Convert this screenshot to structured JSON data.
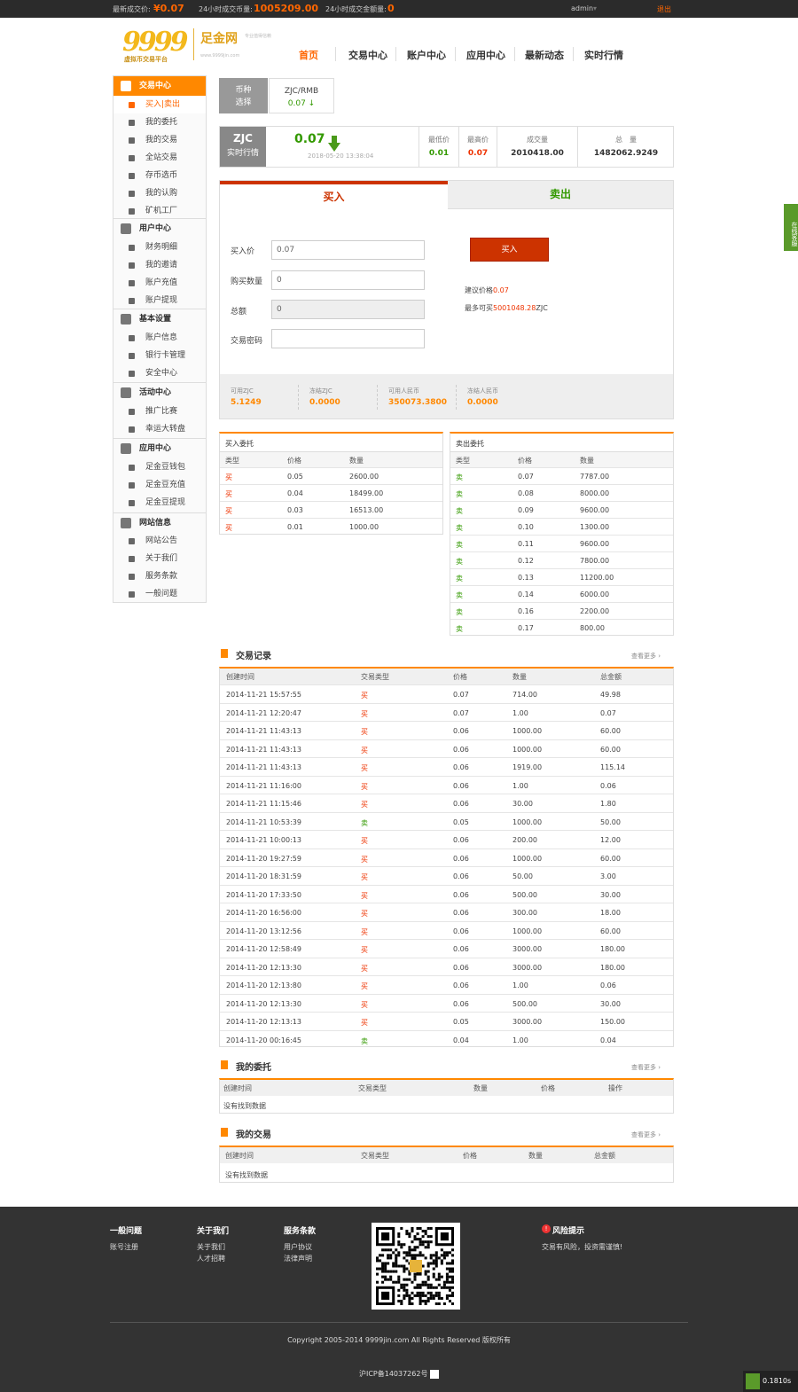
{
  "topbar": {
    "last_price_label": "最新成交价:",
    "last_price": "¥0.07",
    "vol24_label": "24小时成交币量:",
    "vol24": "1005209.00",
    "amt24_label": "24小时成交金额量:",
    "amt24": "0",
    "user": "admin",
    "logout": "退出"
  },
  "logo": {
    "digits": "9999",
    "title": "足金网",
    "slogan": "专业值得信赖",
    "sub": "虚拟币交易平台",
    "url": "www.9999jin.com"
  },
  "nav": [
    "首页",
    "交易中心",
    "账户中心",
    "应用中心",
    "最新动态",
    "实时行情"
  ],
  "sidebar": {
    "groups": [
      {
        "title": "交易中心",
        "items": [
          "买入|卖出",
          "我的委托",
          "我的交易",
          "全站交易",
          "存币选币",
          "我的认购",
          "矿机工厂"
        ]
      },
      {
        "title": "用户中心",
        "items": [
          "财务明细",
          "我的邀请",
          "账户充值",
          "账户提现"
        ]
      },
      {
        "title": "基本设置",
        "items": [
          "账户信息",
          "银行卡管理",
          "安全中心"
        ]
      },
      {
        "title": "活动中心",
        "items": [
          "推广比赛",
          "幸运大转盘"
        ]
      },
      {
        "title": "应用中心",
        "items": [
          "足金豆钱包",
          "足金豆充值",
          "足金豆提现"
        ]
      },
      {
        "title": "网站信息",
        "items": [
          "网站公告",
          "关于我们",
          "服务条款",
          "一般问题"
        ]
      }
    ]
  },
  "coin": {
    "select_label1": "币种",
    "select_label2": "选择",
    "pair": "ZJC/RMB",
    "pair_price": "0.07 ↓"
  },
  "ticker": {
    "code": "ZJC",
    "sub": "实时行情",
    "price": "0.07",
    "time": "2018-05-20 13:38:04",
    "low_label": "最低价",
    "low": "0.01",
    "high_label": "最高价",
    "high": "0.07",
    "vol_label": "成交量",
    "vol": "2010418.00",
    "total_label": "总　量",
    "total": "1482062.9249"
  },
  "trade": {
    "tab_buy": "买入",
    "tab_sell": "卖出",
    "price_label": "买入价",
    "price": "0.07",
    "amount_label": "购买数量",
    "amount": "0",
    "total_label": "总额",
    "total": "0",
    "pwd_label": "交易密码",
    "pwd": "",
    "button": "买入",
    "suggest_label": "建议价格",
    "suggest": "0.07",
    "max_label": "最多可买",
    "max": "5001048.28",
    "max_unit": "ZJC"
  },
  "balances": [
    {
      "label": "可用ZJC",
      "value": "5.1249"
    },
    {
      "label": "冻结ZJC",
      "value": "0.0000"
    },
    {
      "label": "可用人民币",
      "value": "350073.3800"
    },
    {
      "label": "冻结人民币",
      "value": "0.0000"
    }
  ],
  "buy_orders": {
    "title": "买入委托",
    "headers": [
      "类型",
      "价格",
      "数量"
    ],
    "rows": [
      [
        "买",
        "0.05",
        "2600.00"
      ],
      [
        "买",
        "0.04",
        "18499.00"
      ],
      [
        "买",
        "0.03",
        "16513.00"
      ],
      [
        "买",
        "0.01",
        "1000.00"
      ]
    ]
  },
  "sell_orders": {
    "title": "卖出委托",
    "headers": [
      "类型",
      "价格",
      "数量"
    ],
    "rows": [
      [
        "卖",
        "0.07",
        "7787.00"
      ],
      [
        "卖",
        "0.08",
        "8000.00"
      ],
      [
        "卖",
        "0.09",
        "9600.00"
      ],
      [
        "卖",
        "0.10",
        "1300.00"
      ],
      [
        "卖",
        "0.11",
        "9600.00"
      ],
      [
        "卖",
        "0.12",
        "7800.00"
      ],
      [
        "卖",
        "0.13",
        "11200.00"
      ],
      [
        "卖",
        "0.14",
        "6000.00"
      ],
      [
        "卖",
        "0.16",
        "2200.00"
      ],
      [
        "卖",
        "0.17",
        "800.00"
      ]
    ]
  },
  "records": {
    "title": "交易记录",
    "more": "查看更多 ›",
    "headers": [
      "创建时间",
      "交易类型",
      "价格",
      "数量",
      "总金额"
    ],
    "rows": [
      [
        "2014-11-21 15:57:55",
        "买",
        "0.07",
        "714.00",
        "49.98"
      ],
      [
        "2014-11-21 12:20:47",
        "买",
        "0.07",
        "1.00",
        "0.07"
      ],
      [
        "2014-11-21 11:43:13",
        "买",
        "0.06",
        "1000.00",
        "60.00"
      ],
      [
        "2014-11-21 11:43:13",
        "买",
        "0.06",
        "1000.00",
        "60.00"
      ],
      [
        "2014-11-21 11:43:13",
        "买",
        "0.06",
        "1919.00",
        "115.14"
      ],
      [
        "2014-11-21 11:16:00",
        "买",
        "0.06",
        "1.00",
        "0.06"
      ],
      [
        "2014-11-21 11:15:46",
        "买",
        "0.06",
        "30.00",
        "1.80"
      ],
      [
        "2014-11-21 10:53:39",
        "卖",
        "0.05",
        "1000.00",
        "50.00"
      ],
      [
        "2014-11-21 10:00:13",
        "买",
        "0.06",
        "200.00",
        "12.00"
      ],
      [
        "2014-11-20 19:27:59",
        "买",
        "0.06",
        "1000.00",
        "60.00"
      ],
      [
        "2014-11-20 18:31:59",
        "买",
        "0.06",
        "50.00",
        "3.00"
      ],
      [
        "2014-11-20 17:33:50",
        "买",
        "0.06",
        "500.00",
        "30.00"
      ],
      [
        "2014-11-20 16:56:00",
        "买",
        "0.06",
        "300.00",
        "18.00"
      ],
      [
        "2014-11-20 13:12:56",
        "买",
        "0.06",
        "1000.00",
        "60.00"
      ],
      [
        "2014-11-20 12:58:49",
        "买",
        "0.06",
        "3000.00",
        "180.00"
      ],
      [
        "2014-11-20 12:13:30",
        "买",
        "0.06",
        "3000.00",
        "180.00"
      ],
      [
        "2014-11-20 12:13:80",
        "买",
        "0.06",
        "1.00",
        "0.06"
      ],
      [
        "2014-11-20 12:13:30",
        "买",
        "0.06",
        "500.00",
        "30.00"
      ],
      [
        "2014-11-20 12:13:13",
        "买",
        "0.05",
        "3000.00",
        "150.00"
      ],
      [
        "2014-11-20 00:16:45",
        "卖",
        "0.04",
        "1.00",
        "0.04"
      ]
    ]
  },
  "my_orders": {
    "title": "我的委托",
    "more": "查看更多 ›",
    "headers": [
      "创建时间",
      "交易类型",
      "数量",
      "价格",
      "操作"
    ],
    "empty": "没有找到数据"
  },
  "my_trades": {
    "title": "我的交易",
    "more": "查看更多 ›",
    "headers": [
      "创建时间",
      "交易类型",
      "价格",
      "数量",
      "总金额"
    ],
    "empty": "没有找到数据"
  },
  "side_service": "在线客服",
  "footer": {
    "cols": [
      {
        "title": "一般问题",
        "links": [
          "账号注册"
        ]
      },
      {
        "title": "关于我们",
        "links": [
          "关于我们",
          "人才招聘"
        ]
      },
      {
        "title": "服务条款",
        "links": [
          "用户协议",
          "法律声明"
        ]
      }
    ],
    "risk_title": "风险提示",
    "risk_text": "交易有风险，投资需谨慎!",
    "copyright": "Copyright 2005-2014 9999jin.com All Rights Reserved 版权所有",
    "icp": "沪ICP备14037262号",
    "timer": "0.1810s"
  },
  "colors": {
    "accent": "#ff8800",
    "buy": "#cc3300",
    "sell": "#339900",
    "dark": "#333333"
  }
}
